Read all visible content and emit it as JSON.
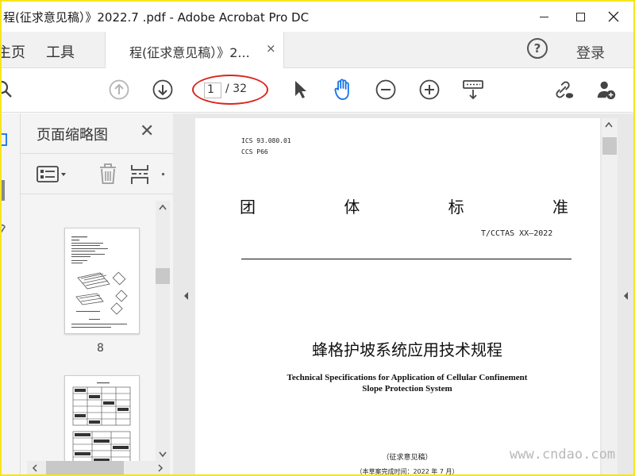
{
  "window": {
    "title": "程(征求意见稿）》2022.7 .pdf - Adobe Acrobat Pro DC"
  },
  "menu": {
    "home": "主页",
    "tools": "工具",
    "tab_label": "程(征求意见稿）》2...",
    "tab_close": "×",
    "help": "?",
    "login": "登录"
  },
  "toolbar": {
    "page_current": "1",
    "page_total": "/ 32"
  },
  "thumbnails": {
    "title": "页面缩略图",
    "close": "✕",
    "page_label": "8"
  },
  "document": {
    "ics_line1": "ICS  93.080.01",
    "ics_line2": "CCS  P66",
    "std_title_chars": [
      "团",
      "体",
      "标",
      "准"
    ],
    "std_number": "T/CCTAS XX—2022",
    "main_title": "蜂格护坡系统应用技术规程",
    "en_title_line1": "Technical Specifications for Application of Cellular Confinement",
    "en_title_line2": "Slope Protection System",
    "draft_note": "（征求意见稿）",
    "date_note": "（本草案完成时间：2022 年 7 月）"
  },
  "watermark": "www.cndao.com",
  "colors": {
    "frame": "#f5e51c",
    "annotation": "#d9261c",
    "hand_tool": "#1473e6"
  }
}
